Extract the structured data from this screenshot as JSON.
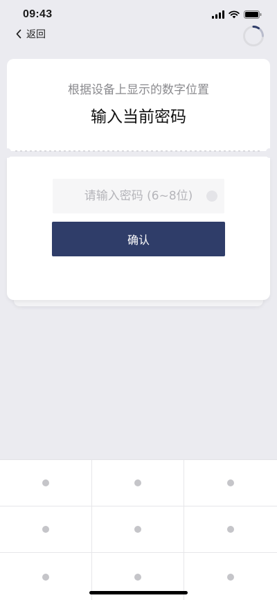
{
  "status_bar": {
    "time": "09:43"
  },
  "nav": {
    "back_label": "返回"
  },
  "card": {
    "subtitle": "根据设备上显示的数字位置",
    "title": "输入当前密码"
  },
  "password": {
    "value": "",
    "placeholder": "请输入密码 (6~8位)"
  },
  "confirm_label": "确认",
  "keypad": {
    "keys": 9
  },
  "colors": {
    "primary": "#2f3d69",
    "background": "#ebebf0",
    "key_dot": "#c5c5c9"
  }
}
